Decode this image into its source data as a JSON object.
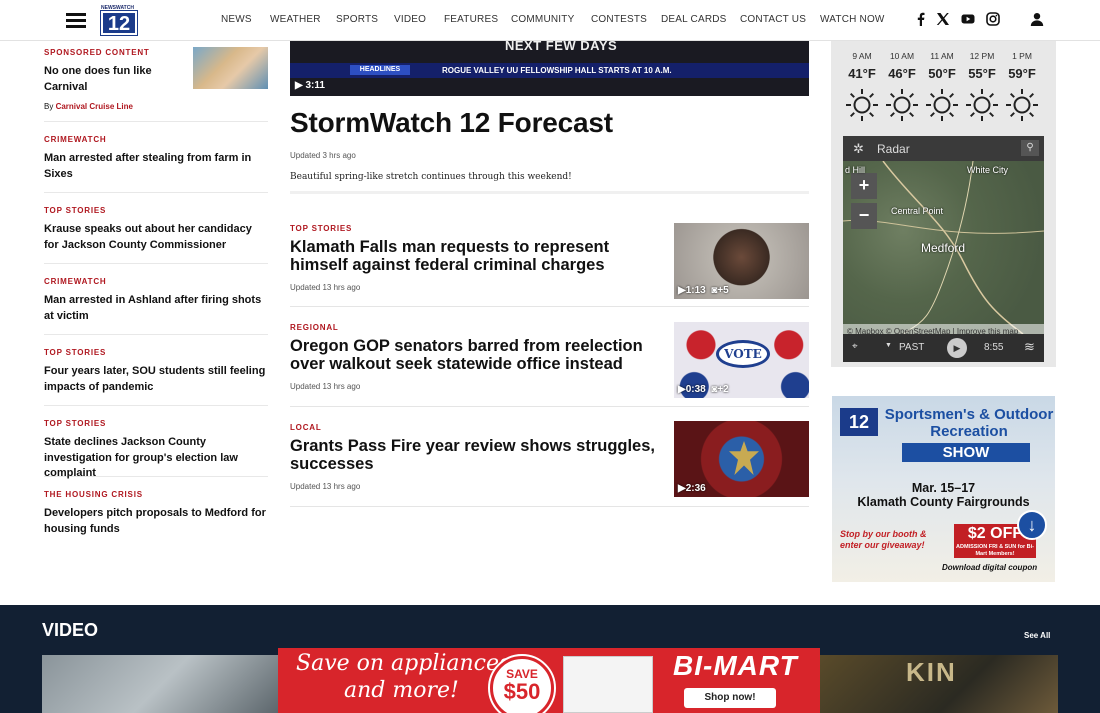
{
  "header": {
    "logo_top": "NEWSWATCH",
    "logo_num": "12",
    "nav": [
      "NEWS",
      "WEATHER",
      "SPORTS",
      "VIDEO",
      "FEATURES",
      "COMMUNITY",
      "CONTESTS",
      "DEAL CARDS",
      "CONTACT US",
      "WATCH NOW"
    ],
    "social_icons": [
      "facebook-icon",
      "x-icon",
      "youtube-icon",
      "instagram-icon",
      "account-icon"
    ]
  },
  "left": {
    "sponsored": {
      "kicker": "SPONSORED CONTENT",
      "title": "No one does fun like Carnival",
      "by_prefix": "By",
      "by_name": "Carnival Cruise Line"
    },
    "items": [
      {
        "kicker": "CRIMEWATCH",
        "title": "Man arrested after stealing from farm in Sixes"
      },
      {
        "kicker": "TOP STORIES",
        "title": "Krause speaks out about her candidacy for Jackson County Commissioner"
      },
      {
        "kicker": "CRIMEWATCH",
        "title": "Man arrested in Ashland after firing shots at victim"
      },
      {
        "kicker": "TOP STORIES",
        "title": "Four years later, SOU students still feeling impacts of pandemic"
      },
      {
        "kicker": "TOP STORIES",
        "title": "State declines Jackson County investigation for group's election law complaint"
      },
      {
        "kicker": "THE HOUSING CRISIS",
        "title": "Developers pitch proposals to Medford for housing funds"
      }
    ]
  },
  "hero": {
    "video_overlay_top": "NEXT FEW DAYS",
    "video_ticker_label": "HEADLINES",
    "video_ticker_text": "ROGUE VALLEY UU FELLOWSHIP HALL STARTS AT 10 A.M.",
    "video_duration": "3:11",
    "title": "StormWatch 12 Forecast",
    "updated": "Updated 3 hrs ago",
    "desc": "Beautiful spring-like stretch continues through this weekend!"
  },
  "stories": [
    {
      "kicker": "TOP STORIES",
      "title": "Klamath Falls man requests to represent himself against federal criminal charges",
      "updated": "Updated 13 hrs ago",
      "duration": "1:13",
      "photos": "+5"
    },
    {
      "kicker": "REGIONAL",
      "title": "Oregon GOP senators barred from reelection over walkout seek statewide office instead",
      "updated": "Updated 13 hrs ago",
      "duration": "0:38",
      "photos": "+2",
      "thumb_text": "VOTE"
    },
    {
      "kicker": "LOCAL",
      "title": "Grants Pass Fire year review shows struggles, successes",
      "updated": "Updated 13 hrs ago",
      "duration": "2:36",
      "photos": ""
    }
  ],
  "weather": {
    "hours": [
      {
        "time": "9 AM",
        "temp": "41°F"
      },
      {
        "time": "10 AM",
        "temp": "46°F"
      },
      {
        "time": "11 AM",
        "temp": "50°F"
      },
      {
        "time": "12 PM",
        "temp": "55°F"
      },
      {
        "time": "1 PM",
        "temp": "59°F"
      }
    ],
    "radar": {
      "title": "Radar",
      "labels": [
        "White City",
        "Central Point",
        "Medford",
        "d Hill"
      ],
      "attribution": "© Mapbox © OpenStreetMap | Improve this map",
      "past_label": "PAST",
      "time": "8:55"
    }
  },
  "ad": {
    "brand": "12",
    "headline": "Sportsmen's & Outdoor Recreation",
    "show": "SHOW",
    "dates": "Mar. 15–17",
    "venue": "Klamath County Fairgrounds",
    "booth": "Stop by our booth & enter our giveaway!",
    "off_amount": "$2 OFF",
    "off_small": "ADMISSION FRI & SUN for Bi-Mart Members!",
    "coupon": "Download digital coupon"
  },
  "video_section": {
    "title": "VIDEO",
    "see_all": "See All",
    "thumb_text": "KIN"
  },
  "banner": {
    "line1": "Save on appliances...",
    "line2": "and more!",
    "save": "SAVE",
    "amount": "$50",
    "brand": "BI-MART",
    "cta": "Shop now!"
  }
}
